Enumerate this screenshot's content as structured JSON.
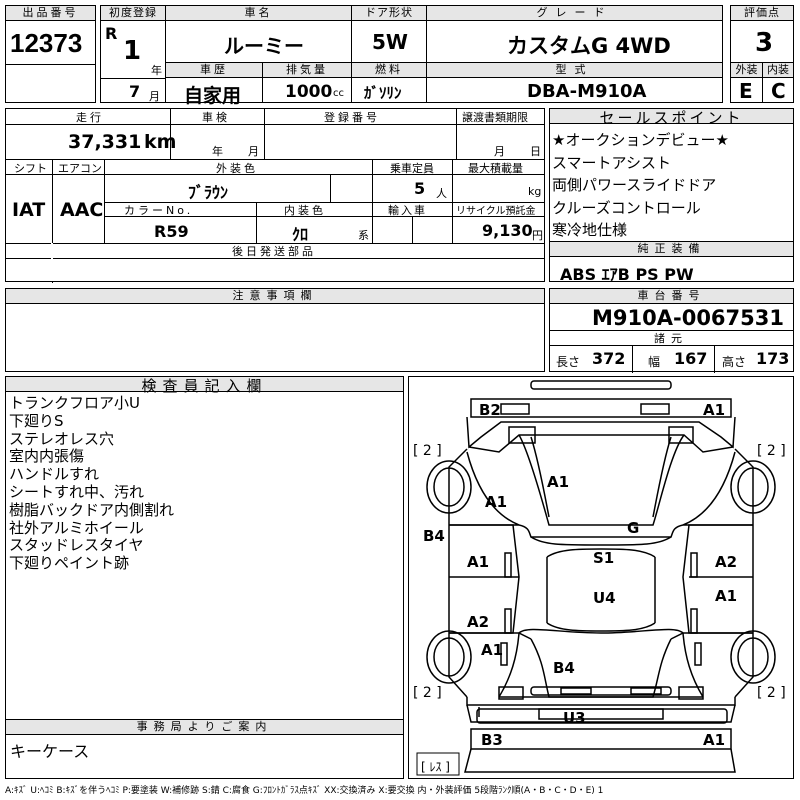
{
  "header": {
    "lot_no_label": "出品番号",
    "lot_no": "12373",
    "first_reg_label": "初度登録",
    "era": "R",
    "year": "1",
    "year_unit": "年",
    "month": "7",
    "month_unit": "月",
    "car_name_label": "車名",
    "car_name": "ルーミー",
    "door_label": "ドア形状",
    "door": "5W",
    "grade_label": "グレード",
    "grade": "カスタムG 4WD",
    "score_label": "評価点",
    "score": "3",
    "history_label": "車歴",
    "history": "自家用",
    "displacement_label": "排気量",
    "displacement": "1000",
    "displacement_unit": "cc",
    "fuel_label": "燃料",
    "fuel": "ｶﾞｿﾘﾝ",
    "model_label": "型式",
    "model": "DBA-M910A",
    "exterior_label": "外装",
    "exterior": "E",
    "interior_label": "内装",
    "interior": "C"
  },
  "row2": {
    "mileage_label": "走行",
    "mileage": "37,331",
    "mileage_unit": "km",
    "inspection_label": "車検",
    "inspection_year_unit": "年",
    "inspection_month_unit": "月",
    "plate_label": "登録番号",
    "transfer_label": "譲渡書類期限",
    "transfer_month_unit": "月",
    "transfer_day_unit": "日",
    "shift_label": "シフト",
    "shift": "IAT",
    "ac_label": "エアコン",
    "ac": "AAC",
    "color_label": "外装色",
    "color": "ﾌﾞﾗｳﾝ",
    "capacity_label": "乗車定員",
    "capacity": "5",
    "capacity_unit": "人",
    "load_label": "最大積載量",
    "load_unit": "kg",
    "color_no_label": "カラーNo.",
    "color_no": "R59",
    "interior_color_label": "内装色",
    "interior_color": "ｸﾛ",
    "interior_color_unit": "系",
    "import_label": "輸入車",
    "recycle_label": "リサイクル預託金",
    "recycle": "9,130",
    "recycle_unit": "円",
    "later_parts_label": "後日発送部品"
  },
  "sales": {
    "label": "セールスポイント",
    "points": [
      "★オークションデビュー★",
      "スマートアシスト",
      "両側パワースライドドア",
      "クルーズコントロール",
      "寒冷地仕様"
    ]
  },
  "equipment": {
    "label": "純正装備",
    "value": "ABS ｴｱB PS PW"
  },
  "notes_label": "注意事項欄",
  "chassis": {
    "label": "車台番号",
    "value": "M910A-0067531",
    "specs_label": "諸元",
    "length_label": "長さ",
    "length": "372",
    "width_label": "幅",
    "width": "167",
    "height_label": "高さ",
    "height": "173"
  },
  "inspector": {
    "label": "検査員記入欄",
    "notes": [
      "トランクフロア小U",
      "下廻りS",
      "ステレオレス穴",
      "室内内張傷",
      "ハンドルすれ",
      "シートすれ中、汚れ",
      "樹脂バックドア内側割れ",
      "社外アルミホイール",
      "スタッドレスタイヤ",
      "下廻りペイント跡"
    ]
  },
  "office": {
    "label": "事務局よりご案内",
    "value": "キーケース"
  },
  "diagram": {
    "marks": {
      "b2": "B2",
      "a1_front_right": "A1",
      "a1_hood": "A1",
      "a1_left_fender": "A1",
      "g_windshield": "G",
      "b4_left": "B4",
      "s1_roof": "S1",
      "a1_left_door": "A1",
      "a2_right_door": "A2",
      "u4_roof": "U4",
      "a1_right_rear": "A1",
      "a2_left_rear": "A2",
      "a1_left_quarter": "A1",
      "b4_back": "B4",
      "u3_bumper": "U3",
      "b3_rear_left": "B3",
      "a1_rear_right": "A1"
    },
    "tire_tl": "[ 2 ]",
    "tire_tr": "[ 2 ]",
    "tire_bl": "[ 2 ]",
    "tire_br": "[ 2 ]",
    "spare": "[ ﾚｽ ]"
  },
  "legend": "A:ｷｽﾞ U:ﾍｺﾐ B:ｷｽﾞを伴うﾍｺﾐ P:要塗装 W:補修跡 S:錆 C:腐食 G:ﾌﾛﾝﾄｶﾞﾗｽ点ｷｽﾞ XX:交換済み X:要交換 内・外装評価 5段階ﾗﾝｸ順(A・B・C・D・E) 1"
}
